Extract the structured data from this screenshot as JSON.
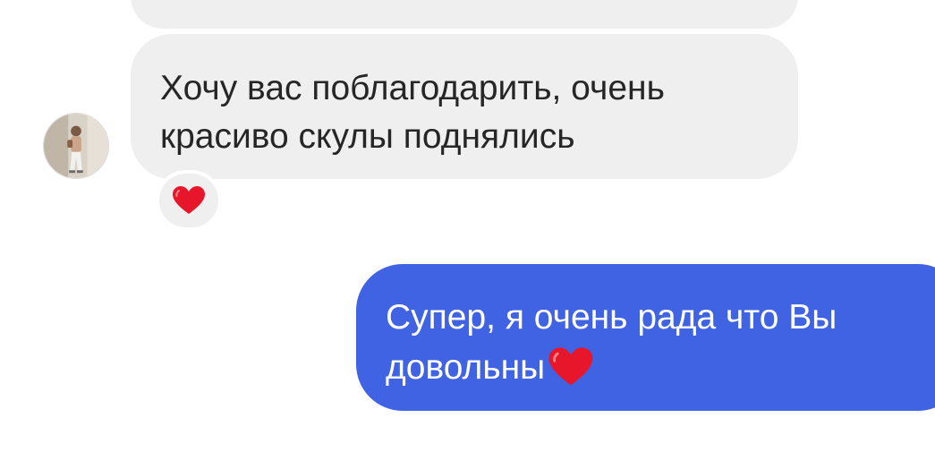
{
  "chat": {
    "incoming": {
      "text": "Хочу вас поблагодарить, очень\nкрасиво скулы поднялись",
      "reaction_icon": "red-heart-icon"
    },
    "outgoing": {
      "text": "Супер, я очень рада что Вы довольны",
      "trailing_icon": "red-heart-icon"
    },
    "avatar_icon": "user-photo-avatar"
  },
  "colors": {
    "incoming_bubble": "#efefef",
    "outgoing_bubble": "#3f63e2",
    "heart": "#e8162b"
  }
}
